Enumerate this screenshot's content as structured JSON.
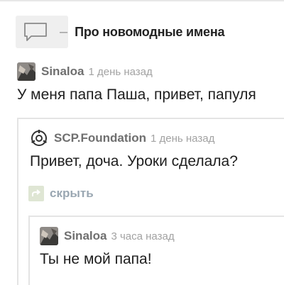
{
  "section": {
    "title": "Про новомодные имена",
    "icon": "comment-bubble-icon"
  },
  "comments": [
    {
      "author": "Sinaloa",
      "time": "1 день назад",
      "text": "У меня папа Паша, привет, папуля",
      "avatar": "user-avatar-image"
    },
    {
      "author": "SCP.Foundation",
      "time": "1 день назад",
      "text": "Привет, доча. Уроки сделала?",
      "avatar": "scp-logo-icon"
    },
    {
      "author": "Sinaloa",
      "time": "3 часа назад",
      "text": "Ты не мой папа!",
      "avatar": "user-avatar-image"
    }
  ],
  "collapse": {
    "label": "скрыть",
    "icon": "collapse-arrow-icon"
  },
  "colors": {
    "author": "#6f6f6f",
    "time": "#a2a2a2",
    "collapse_label": "#9aa7b2",
    "thread_line": "#e4e4e4"
  }
}
